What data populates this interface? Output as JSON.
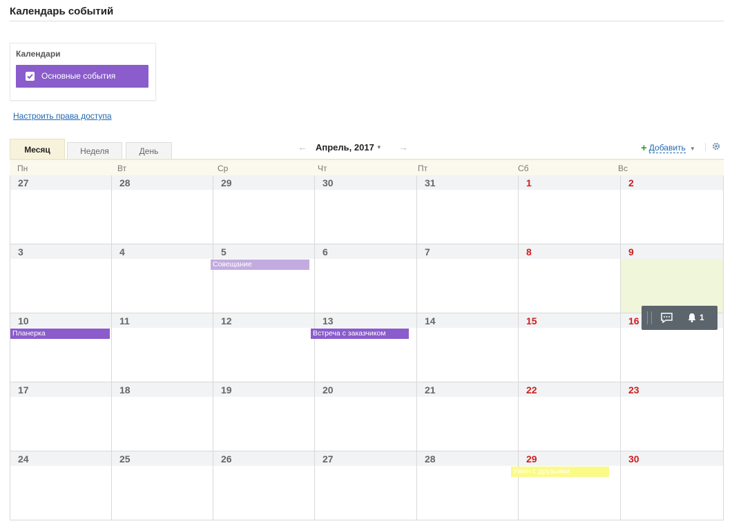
{
  "page": {
    "title": "Календарь событий"
  },
  "calendars": {
    "title": "Календари",
    "items": [
      {
        "label": "Основные события",
        "checked": true,
        "color": "#8a5ccc"
      }
    ]
  },
  "access_link": "Настроить права доступа",
  "views": {
    "month": "Месяц",
    "week": "Неделя",
    "day": "День",
    "active": "month"
  },
  "nav": {
    "prev": "←",
    "next": "→",
    "title": "Апрель, 2017"
  },
  "toolbar": {
    "add_label": "Добавить",
    "settings_icon": "gear-icon"
  },
  "weekdays": [
    "Пн",
    "Вт",
    "Ср",
    "Чт",
    "Пт",
    "Сб",
    "Вс"
  ],
  "weeks": [
    [
      "27",
      "28",
      "29",
      "30",
      "31",
      "1",
      "2"
    ],
    [
      "3",
      "4",
      "5",
      "6",
      "7",
      "8",
      "9"
    ],
    [
      "10",
      "11",
      "12",
      "13",
      "14",
      "15",
      "16"
    ],
    [
      "17",
      "18",
      "19",
      "20",
      "21",
      "22",
      "23"
    ],
    [
      "24",
      "25",
      "26",
      "27",
      "28",
      "29",
      "30"
    ]
  ],
  "highlighted_day": "9",
  "events": [
    {
      "title": "Совещание",
      "day": "5",
      "color": "#c3abe0",
      "text_color": "#ffffff"
    },
    {
      "title": "Планерка",
      "day": "10",
      "color": "#8a5ccc",
      "text_color": "#ffffff"
    },
    {
      "title": "Встреча с заказчиком",
      "day": "13",
      "color": "#8a5ccc",
      "text_color": "#ffffff"
    },
    {
      "title": "Ужин с друзьями",
      "day": "29",
      "color": "#fafa87",
      "text_color": "#ffffff"
    }
  ],
  "float_panel": {
    "chat_icon": "chat-icon",
    "bell_icon": "bell-icon",
    "notifications": "1"
  },
  "colors": {
    "accent": "#8a5ccc",
    "weekend": "#cc1e1e",
    "link": "#2067b0"
  }
}
